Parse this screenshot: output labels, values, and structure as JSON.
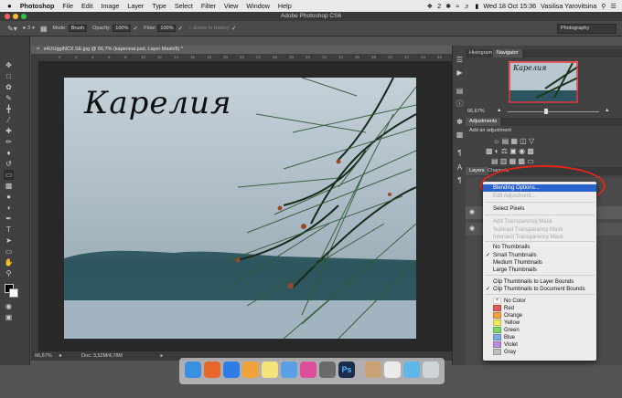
{
  "menubar": {
    "apple": "",
    "app_name": "Photoshop",
    "items": [
      "File",
      "Edit",
      "Image",
      "Layer",
      "Type",
      "Select",
      "Filter",
      "View",
      "Window",
      "Help"
    ],
    "status_extra": "2",
    "clock": "Wed 18 Oct  15:36",
    "user": "Vasilisa Yarovitsina"
  },
  "window": {
    "title": "Adobe Photoshop CS6"
  },
  "options_bar": {
    "brush_size": "3",
    "mode_label": "Mode:",
    "mode_value": "Brush",
    "opacity_label": "Opacity:",
    "opacity_value": "100%",
    "flow_label": "Flow:",
    "flow_value": "100%",
    "erase_to_history": "Erase to History",
    "workspace": "Photography"
  },
  "document": {
    "tab_title": "x4UUggiNCX.SE.jpg @ 66,7% (kapeneai.psd, Layer Mask/8) *",
    "ruler_ticks": [
      "0",
      "2",
      "4",
      "6",
      "8",
      "10",
      "12",
      "14",
      "16",
      "18",
      "20",
      "22",
      "24",
      "26",
      "28",
      "30",
      "32",
      "34",
      "36",
      "38",
      "40",
      "42",
      "44",
      "46"
    ],
    "overlay_text": "Карелия",
    "zoom": "66,67%",
    "doc_info": "Doc: 3,52M/4,78M"
  },
  "panels": {
    "top_tabs": [
      "Histogram",
      "Navigator"
    ],
    "nav_zoom": "66,67%",
    "adjustments_tab": "Adjustments",
    "add_adjustment": "Add an adjustment",
    "layers_tabs": [
      "Layers",
      "Channels"
    ]
  },
  "context_menu": {
    "items": [
      {
        "label": "Blending Options...",
        "state": "highlighted"
      },
      {
        "label": "Edit Adjustment...",
        "state": "disabled"
      },
      {
        "label": "Select Pixels",
        "state": "normal"
      },
      {
        "label": "Add Transparency Mask",
        "state": "disabled"
      },
      {
        "label": "Subtract Transparency Mask",
        "state": "disabled"
      },
      {
        "label": "Intersect Transparency Mask",
        "state": "disabled"
      },
      {
        "label": "No Thumbnails",
        "state": "normal"
      },
      {
        "label": "Small Thumbnails",
        "state": "checked"
      },
      {
        "label": "Medium Thumbnails",
        "state": "normal"
      },
      {
        "label": "Large Thumbnails",
        "state": "normal"
      },
      {
        "label": "Clip Thumbnails to Layer Bounds",
        "state": "normal"
      },
      {
        "label": "Clip Thumbnails to Document Bounds",
        "state": "checked"
      }
    ],
    "colors": [
      {
        "label": "No Color",
        "color": "none"
      },
      {
        "label": "Red",
        "color": "#e05a5a"
      },
      {
        "label": "Orange",
        "color": "#f0a040"
      },
      {
        "label": "Yellow",
        "color": "#ecec60"
      },
      {
        "label": "Green",
        "color": "#7fd46a"
      },
      {
        "label": "Blue",
        "color": "#7fa8e6"
      },
      {
        "label": "Violet",
        "color": "#b690e0"
      },
      {
        "label": "Gray",
        "color": "#bdbdbd"
      }
    ]
  },
  "dock": {
    "apps": [
      "finder-icon",
      "firefox-icon",
      "safari-icon",
      "ibooks-icon",
      "notes-icon",
      "preview-icon",
      "itunes-icon",
      "screenshot-icon",
      "photoshop-icon",
      "contacts-icon",
      "slides-icon",
      "photos-icon",
      "trash-icon"
    ],
    "photoshop_label": "Ps"
  },
  "colors": {
    "highlight": "#2a62cc",
    "annotation_ring": "#e1261c",
    "panel_bg": "#424242"
  }
}
